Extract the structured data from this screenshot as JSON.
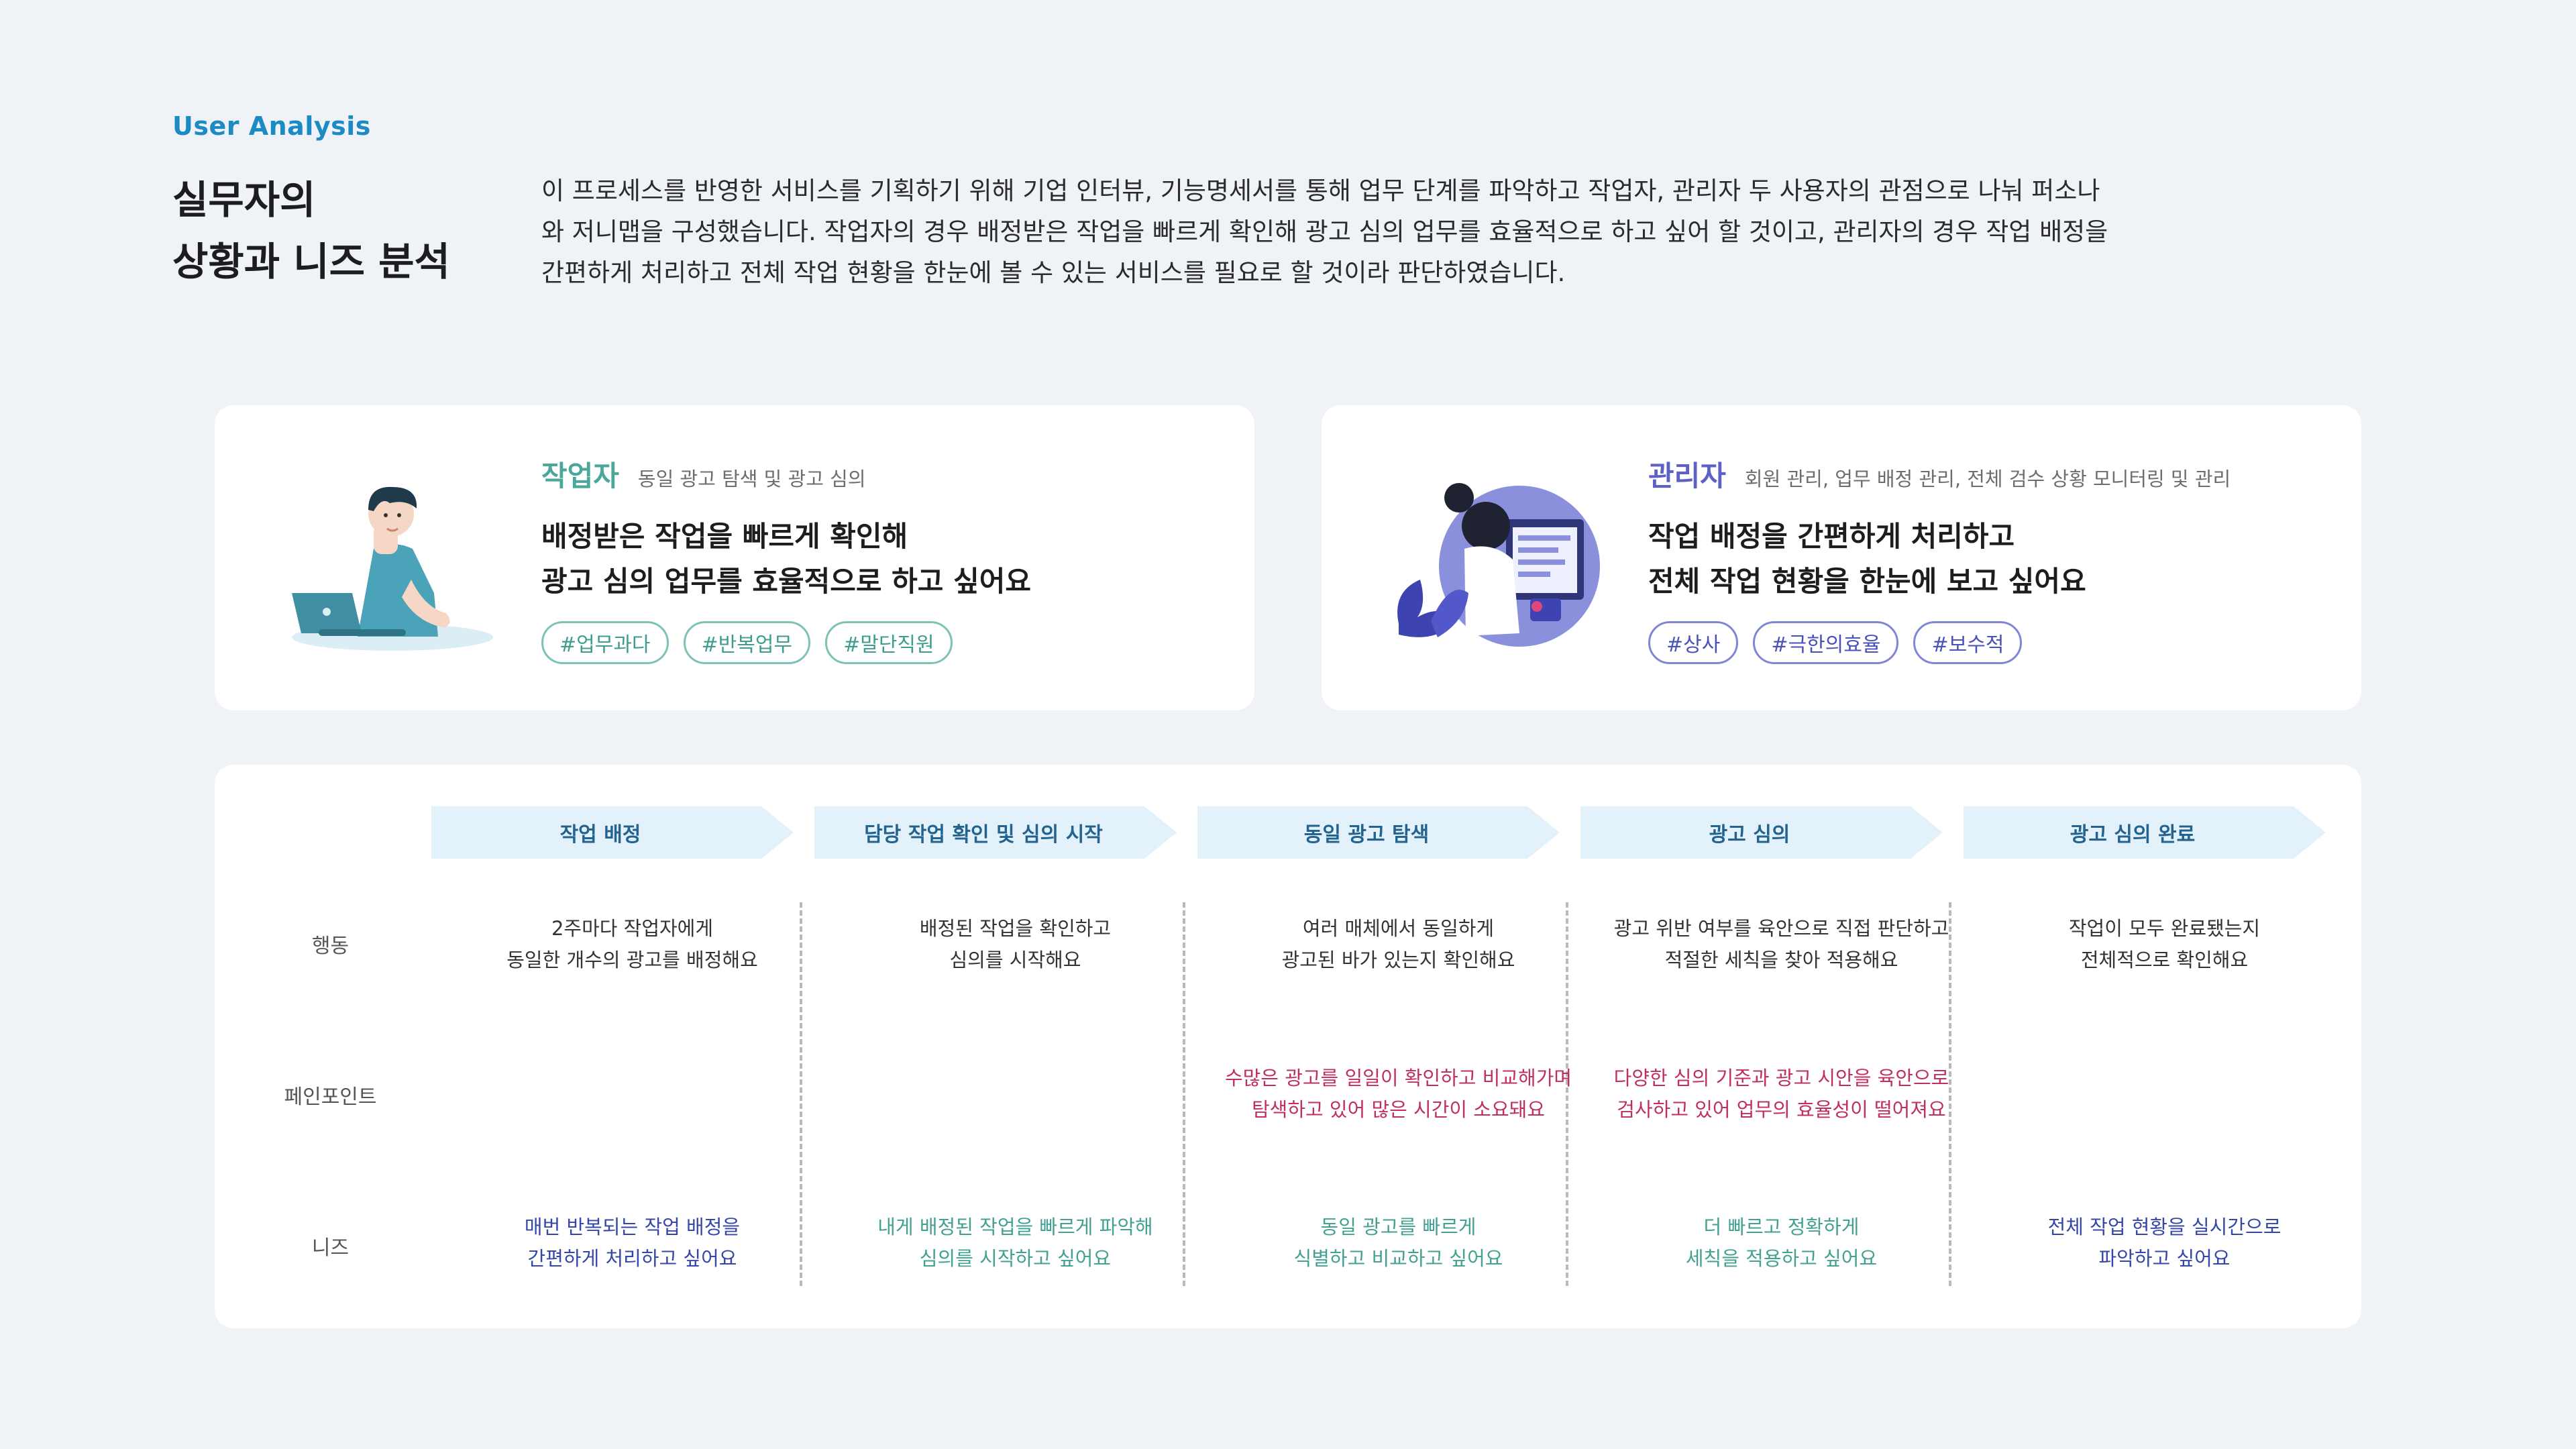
{
  "header": {
    "eyebrow": "User Analysis",
    "headline": "실무자의\n상황과 니즈 분석",
    "intro": "이 프로세스를 반영한 서비스를 기획하기 위해 기업 인터뷰, 기능명세서를 통해 업무 단계를 파악하고 작업자, 관리자 두 사용자의 관점으로 나눠 퍼소나\n와 저니맵을 구성했습니다. 작업자의 경우 배정받은 작업을 빠르게 확인해 광고 심의 업무를 효율적으로 하고 싶어 할 것이고, 관리자의 경우 작업 배정을\n간편하게 처리하고 전체 작업 현황을 한눈에 볼 수 있는 서비스를 필요로 할 것이라 판단하였습니다."
  },
  "personas": [
    {
      "role": "작업자",
      "desc": "동일 광고 탐색 및 광고 심의",
      "quote": "배정받은 작업을 빠르게 확인해\n광고 심의 업무를 효율적으로 하고 싶어요",
      "tags": [
        "#업무과다",
        "#반복업무",
        "#말단직원"
      ],
      "icon": "worker-illustration"
    },
    {
      "role": "관리자",
      "desc": "회원 관리, 업무 배정 관리, 전체 검수 상황 모니터링 및 관리",
      "quote": "작업 배정을 간편하게 처리하고\n전체 작업 현황을 한눈에 보고 싶어요",
      "tags": [
        "#상사",
        "#극한의효율",
        "#보수적"
      ],
      "icon": "manager-illustration"
    }
  ],
  "journey": {
    "row_labels": [
      "행동",
      "페인포인트",
      "니즈"
    ],
    "steps": [
      {
        "title": "작업 배정",
        "action": "2주마다 작업자에게\n동일한 개수의 광고를 배정해요",
        "pain": "",
        "need": "매번 반복되는 작업 배정을\n간편하게 처리하고 싶어요",
        "need_color": "#3547a8"
      },
      {
        "title": "담당 작업 확인 및 심의 시작",
        "action": "배정된 작업을 확인하고\n심의를 시작해요",
        "pain": "",
        "need": "내게 배정된 작업을 빠르게 파악해\n심의를 시작하고 싶어요",
        "need_color": "#43a192"
      },
      {
        "title": "동일 광고 탐색",
        "action": "여러 매체에서 동일하게\n광고된 바가 있는지 확인해요",
        "pain": "수많은 광고를 일일이 확인하고 비교해가며\n탐색하고 있어 많은 시간이 소요돼요",
        "need": "동일 광고를 빠르게\n식별하고 비교하고 싶어요",
        "need_color": "#43a192"
      },
      {
        "title": "광고 심의",
        "action": "광고 위반 여부를 육안으로 직접 판단하고\n적절한 세칙을 찾아 적용해요",
        "pain": "다양한 심의 기준과 광고 시안을 육안으로\n검사하고 있어 업무의 효율성이 떨어져요",
        "need": "더 빠르고 정확하게\n세칙을 적용하고 싶어요",
        "need_color": "#43a192"
      },
      {
        "title": "광고 심의 완료",
        "action": "작업이 모두 완료됐는지\n전체적으로 확인해요",
        "pain": "",
        "need": "전체 작업 현황을 실시간으로\n파악하고 싶어요",
        "need_color": "#3547a8"
      }
    ]
  },
  "colors": {
    "accent": "#1c8bc4",
    "worker": "#4aa79a",
    "manager": "#5b61c7",
    "pain": "#c0305d",
    "background": "#eff2f7"
  }
}
